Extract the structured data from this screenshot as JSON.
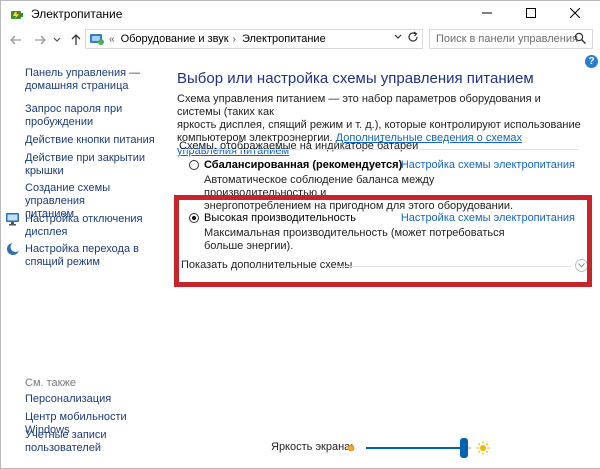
{
  "window": {
    "title": "Электропитание"
  },
  "address_bar": {
    "separator": "«",
    "breadcrumb": [
      "Оборудование и звук",
      "Электропитание"
    ],
    "search_placeholder": "Поиск в панели управления"
  },
  "sidebar": {
    "links": [
      {
        "label": "Панель управления —",
        "label2": "домашняя страница",
        "icon": null
      },
      {
        "label": "Запрос пароля при",
        "label2": "пробуждении",
        "icon": null
      },
      {
        "label": "Действие кнопки питания",
        "label2": "",
        "icon": null
      },
      {
        "label": "Действие при закрытии",
        "label2": "крышки",
        "icon": null
      },
      {
        "label": "Создание схемы управления",
        "label2": "питанием",
        "icon": null
      },
      {
        "label": "Настройка отключения",
        "label2": "дисплея",
        "icon": "monitor-icon"
      },
      {
        "label": "Настройка перехода в",
        "label2": "спящий режим",
        "icon": "moon-icon"
      }
    ],
    "see_also": "См. также",
    "see_also_links": [
      {
        "label": "Персонализация",
        "label2": ""
      },
      {
        "label": "Центр мобильности Windows",
        "label2": ""
      },
      {
        "label": "Учетные записи",
        "label2": "пользователей"
      }
    ]
  },
  "main": {
    "heading": "Выбор или настройка схемы управления питанием",
    "description_lines": [
      "Схема управления питанием — это набор параметров оборудования и системы (таких как",
      "яркость дисплея, спящий режим и т. д.), которые контролируют использование",
      "компьютером электроэнергии."
    ],
    "description_link": "Дополнительные сведения о схемах управления питанием",
    "group_label": "Схемы, отображаемые на индикаторе батареи",
    "plans": [
      {
        "name": "Сбалансированная (рекомендуется)",
        "selected": false,
        "link": "Настройка схемы электропитания",
        "desc_lines": [
          "Автоматическое соблюдение баланса между производительностью и",
          "энергопотреблением на пригодном для этого оборудовании."
        ]
      },
      {
        "name": "Высокая производительность",
        "selected": true,
        "link": "Настройка схемы электропитания",
        "desc_lines": [
          "Максимальная производительность (может потребоваться больше энергии)."
        ]
      }
    ],
    "show_more": "Показать дополнительные схемы",
    "highlight_color": "#c8242b"
  },
  "brightness": {
    "label": "Яркость экрана:",
    "level": 0.93,
    "accent": "#0063b1"
  },
  "colors": {
    "heading": "#1e3287",
    "link": "#1565c0",
    "sidebar_link": "#1c3c78"
  }
}
